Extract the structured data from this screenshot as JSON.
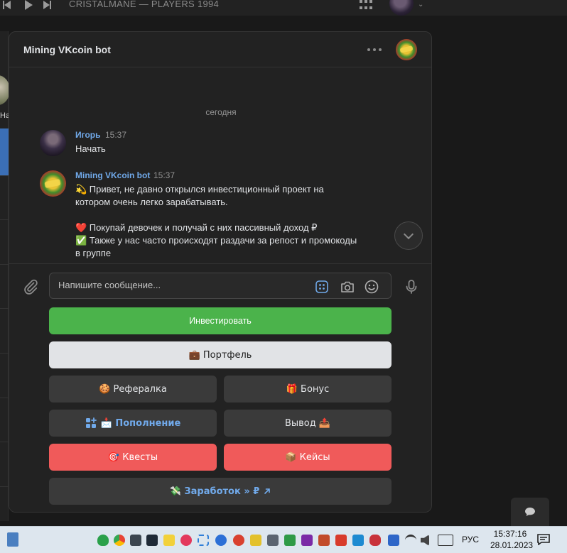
{
  "topbar": {
    "track_title": "CRISTALMANE — PLAYERS 1994"
  },
  "left_panel": {
    "peek_label": "На"
  },
  "chat": {
    "title": "Mining VKcoin bot",
    "day_divider": "сегодня",
    "messages": [
      {
        "author": "Игорь",
        "time": "15:37",
        "lines": [
          "Начать"
        ]
      },
      {
        "author": "Mining VKcoin bot",
        "time": "15:37",
        "lines": [
          "💫 Привет, не давно открылся инвестиционный проект на",
          "котором очень легко зарабатывать.",
          "",
          "❤️ Покупай девочек и получай с них пассивный доход ₽",
          "✅ Также у нас часто происходят раздачи за репост и промокоды",
          "в группе"
        ]
      }
    ]
  },
  "composer": {
    "placeholder": "Напишите сообщение..."
  },
  "keyboard": {
    "invest": "Инвестировать",
    "portfolio": "💼 Портфель",
    "referral": "🍪 Рефералка",
    "bonus": "🎁 Бонус",
    "deposit": "📩 Пополнение",
    "withdraw": "Вывод 📤",
    "quests": "🎯 Квесты",
    "cases": "📦 Кейсы",
    "earnings": "💸 Заработок » ₽"
  },
  "taskbar": {
    "language": "РУС",
    "time": "15:37:16",
    "date": "28.01.2023"
  },
  "colors": {
    "accent_blue": "#71aaeb",
    "invest_green": "#4bb34b",
    "danger_red": "#f05a5a",
    "panel": "#222222"
  }
}
